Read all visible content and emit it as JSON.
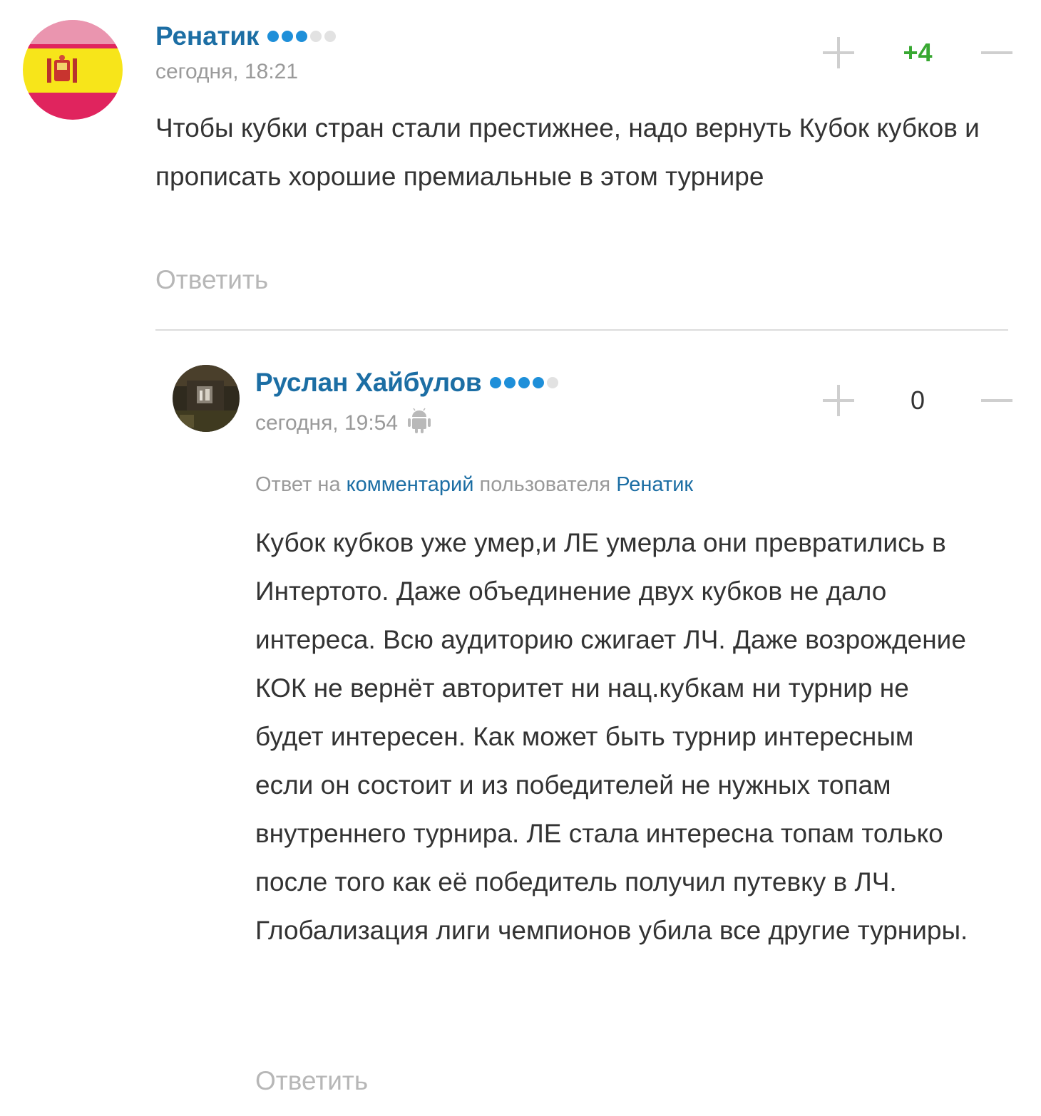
{
  "comments": [
    {
      "author": "Ренатик",
      "rating_dots_filled": 3,
      "rating_dots_total": 5,
      "time": "сегодня, 18:21",
      "score": "+4",
      "text": "Чтобы кубки стран стали престижнее, надо вернуть Кубок кубков и прописать хорошие премиальные в этом турнире",
      "reply_label": "Ответить"
    },
    {
      "author": "Руслан Хайбулов",
      "rating_dots_filled": 4,
      "rating_dots_total": 5,
      "time": "сегодня, 19:54",
      "device_icon": "android-icon",
      "score": "0",
      "reply_to": {
        "prefix": "Ответ на",
        "comment_link": "комментарий",
        "middle": "пользователя",
        "user_link": "Ренатик"
      },
      "text": "Кубок кубков уже умер,и ЛЕ умерла они превратились в Интертото. Даже объединение двух кубков не дало интереса. Всю аудиторию сжигает ЛЧ. Даже возрождение КОК не вернёт авторитет ни нац.кубкам ни турнир не будет интересен. Как может быть турнир интересным если он состоит и из победителей не нужных топам внутреннего турнира. ЛЕ стала интересна топам только после того как её победитель получил путевку в ЛЧ. Глобализация лиги чемпионов убила все другие турниры.",
      "reply_label": "Ответить"
    }
  ],
  "colors": {
    "author_link": "#1c6ea4",
    "rating_dot_on": "#1e8fd9",
    "rating_dot_off": "#e2e2e2",
    "score_positive": "#38a832",
    "muted_text": "#9a9a9a",
    "reply_link": "#b7b7b7"
  }
}
